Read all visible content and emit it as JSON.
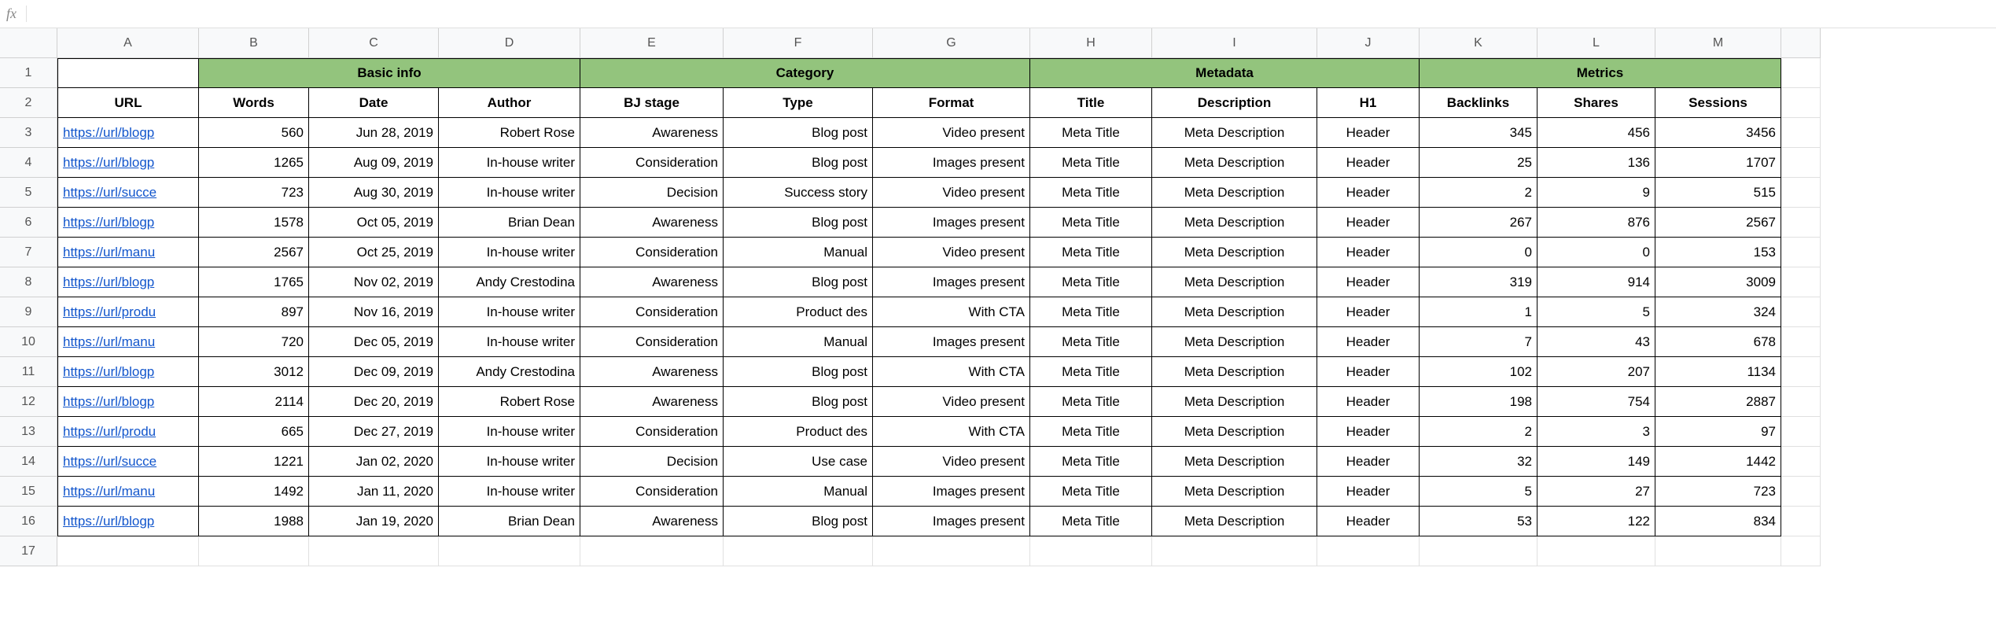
{
  "formula_bar": {
    "fx_label": "fx",
    "value": ""
  },
  "col_letters": [
    "A",
    "B",
    "C",
    "D",
    "E",
    "F",
    "G",
    "H",
    "I",
    "J",
    "K",
    "L",
    "M"
  ],
  "row_numbers": [
    "1",
    "2",
    "3",
    "4",
    "5",
    "6",
    "7",
    "8",
    "9",
    "10",
    "11",
    "12",
    "13",
    "14",
    "15",
    "16",
    "17"
  ],
  "groups": {
    "basic_info": "Basic info",
    "category": "Category",
    "metadata": "Metadata",
    "metrics": "Metrics"
  },
  "headers": {
    "url": "URL",
    "words": "Words",
    "date": "Date",
    "author": "Author",
    "bj_stage": "BJ stage",
    "type": "Type",
    "format": "Format",
    "title": "Title",
    "description": "Description",
    "h1": "H1",
    "backlinks": "Backlinks",
    "shares": "Shares",
    "sessions": "Sessions"
  },
  "rows": [
    {
      "url": "https://url/blogp",
      "words": "560",
      "date": "Jun 28, 2019",
      "author": "Robert Rose",
      "bj": "Awareness",
      "type": "Blog post",
      "format": "Video present",
      "title": "Meta Title",
      "desc": "Meta Description",
      "h1": "Header",
      "backlinks": "345",
      "shares": "456",
      "sessions": "3456"
    },
    {
      "url": "https://url/blogp",
      "words": "1265",
      "date": "Aug 09, 2019",
      "author": "In-house writer",
      "bj": "Consideration",
      "type": "Blog post",
      "format": "Images present",
      "title": "Meta Title",
      "desc": "Meta Description",
      "h1": "Header",
      "backlinks": "25",
      "shares": "136",
      "sessions": "1707"
    },
    {
      "url": "https://url/succe",
      "words": "723",
      "date": "Aug 30, 2019",
      "author": "In-house writer",
      "bj": "Decision",
      "type": "Success story",
      "format": "Video present",
      "title": "Meta Title",
      "desc": "Meta Description",
      "h1": "Header",
      "backlinks": "2",
      "shares": "9",
      "sessions": "515"
    },
    {
      "url": "https://url/blogp",
      "words": "1578",
      "date": "Oct 05, 2019",
      "author": "Brian Dean",
      "bj": "Awareness",
      "type": "Blog post",
      "format": "Images present",
      "title": "Meta Title",
      "desc": "Meta Description",
      "h1": "Header",
      "backlinks": "267",
      "shares": "876",
      "sessions": "2567"
    },
    {
      "url": "https://url/manu",
      "words": "2567",
      "date": "Oct 25, 2019",
      "author": "In-house writer",
      "bj": "Consideration",
      "type": "Manual",
      "format": "Video present",
      "title": "Meta Title",
      "desc": "Meta Description",
      "h1": "Header",
      "backlinks": "0",
      "shares": "0",
      "sessions": "153"
    },
    {
      "url": "https://url/blogp",
      "words": "1765",
      "date": "Nov 02, 2019",
      "author": "Andy Crestodina",
      "bj": "Awareness",
      "type": "Blog post",
      "format": "Images present",
      "title": "Meta Title",
      "desc": "Meta Description",
      "h1": "Header",
      "backlinks": "319",
      "shares": "914",
      "sessions": "3009"
    },
    {
      "url": "https://url/produ",
      "words": "897",
      "date": "Nov 16, 2019",
      "author": "In-house writer",
      "bj": "Consideration",
      "type": "Product des",
      "format": "With CTA",
      "title": "Meta Title",
      "desc": "Meta Description",
      "h1": "Header",
      "backlinks": "1",
      "shares": "5",
      "sessions": "324"
    },
    {
      "url": "https://url/manu",
      "words": "720",
      "date": "Dec 05, 2019",
      "author": "In-house writer",
      "bj": "Consideration",
      "type": "Manual",
      "format": "Images present",
      "title": "Meta Title",
      "desc": "Meta Description",
      "h1": "Header",
      "backlinks": "7",
      "shares": "43",
      "sessions": "678"
    },
    {
      "url": "https://url/blogp",
      "words": "3012",
      "date": "Dec 09, 2019",
      "author": "Andy Crestodina",
      "bj": "Awareness",
      "type": "Blog post",
      "format": "With CTA",
      "title": "Meta Title",
      "desc": "Meta Description",
      "h1": "Header",
      "backlinks": "102",
      "shares": "207",
      "sessions": "1134"
    },
    {
      "url": "https://url/blogp",
      "words": "2114",
      "date": "Dec 20, 2019",
      "author": "Robert Rose",
      "bj": "Awareness",
      "type": "Blog post",
      "format": "Video present",
      "title": "Meta Title",
      "desc": "Meta Description",
      "h1": "Header",
      "backlinks": "198",
      "shares": "754",
      "sessions": "2887"
    },
    {
      "url": "https://url/produ",
      "words": "665",
      "date": "Dec 27, 2019",
      "author": "In-house writer",
      "bj": "Consideration",
      "type": "Product des",
      "format": "With CTA",
      "title": "Meta Title",
      "desc": "Meta Description",
      "h1": "Header",
      "backlinks": "2",
      "shares": "3",
      "sessions": "97"
    },
    {
      "url": "https://url/succe",
      "words": "1221",
      "date": "Jan 02, 2020",
      "author": "In-house writer",
      "bj": "Decision",
      "type": "Use case",
      "format": "Video present",
      "title": "Meta Title",
      "desc": "Meta Description",
      "h1": "Header",
      "backlinks": "32",
      "shares": "149",
      "sessions": "1442"
    },
    {
      "url": "https://url/manu",
      "words": "1492",
      "date": "Jan 11, 2020",
      "author": "In-house writer",
      "bj": "Consideration",
      "type": "Manual",
      "format": "Images present",
      "title": "Meta Title",
      "desc": "Meta Description",
      "h1": "Header",
      "backlinks": "5",
      "shares": "27",
      "sessions": "723"
    },
    {
      "url": "https://url/blogp",
      "words": "1988",
      "date": "Jan 19, 2020",
      "author": "Brian Dean",
      "bj": "Awareness",
      "type": "Blog post",
      "format": "Images present",
      "title": "Meta Title",
      "desc": "Meta Description",
      "h1": "Header",
      "backlinks": "53",
      "shares": "122",
      "sessions": "834"
    }
  ]
}
